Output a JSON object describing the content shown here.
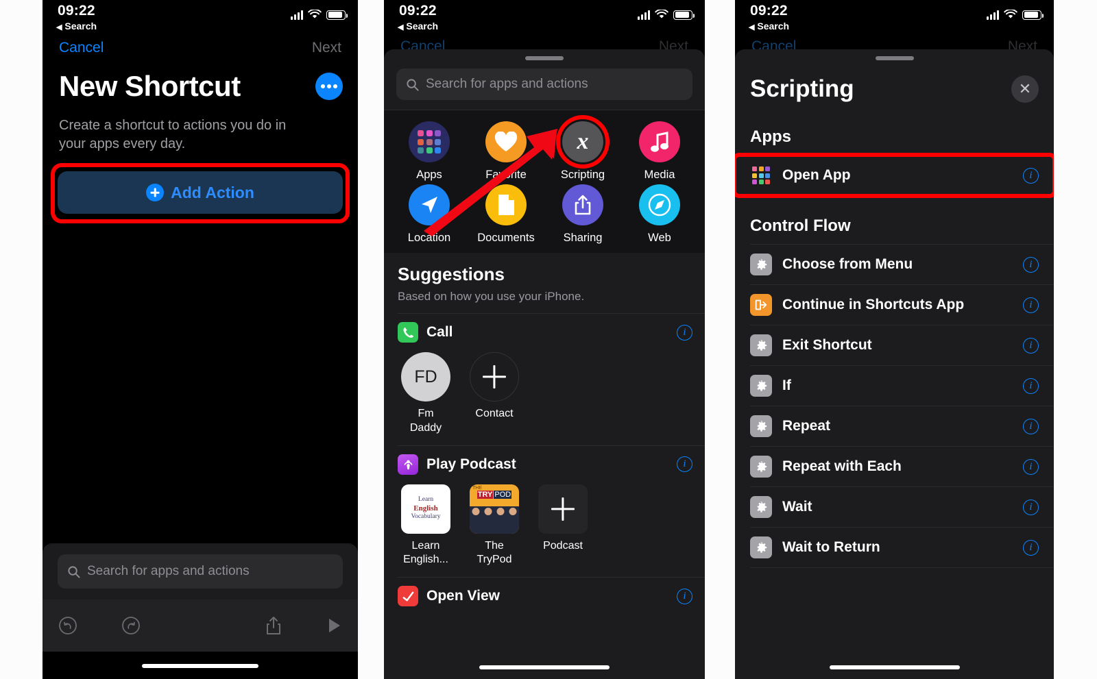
{
  "statusbar": {
    "time": "09:22",
    "back_label": "Search",
    "back_arrow": "◀"
  },
  "phone1": {
    "nav": {
      "cancel": "Cancel",
      "next": "Next"
    },
    "title": "New Shortcut",
    "more_icon": "ellipsis-icon",
    "subtitle": "Create a shortcut to actions you do in your apps every day.",
    "add_action_label": "Add Action",
    "search_placeholder": "Search for apps and actions",
    "toolbar": {
      "undo": "undo-icon",
      "redo": "redo-icon",
      "share": "share-icon",
      "play": "play-icon"
    }
  },
  "phone2": {
    "nav": {
      "cancel": "Cancel",
      "next": "Next"
    },
    "search_placeholder": "Search for apps and actions",
    "categories": [
      {
        "label": "Apps",
        "icon": "app-grid-icon",
        "color": "#2b2b63"
      },
      {
        "label": "Favorite",
        "icon": "heart-icon",
        "color": "#f59a23"
      },
      {
        "label": "Scripting",
        "icon": "x-script-icon",
        "color": "#555558",
        "highlighted": true
      },
      {
        "label": "Media",
        "icon": "music-note-icon",
        "color": "#f2256a"
      },
      {
        "label": "Location",
        "icon": "navigation-icon",
        "color": "#1a84f5"
      },
      {
        "label": "Documents",
        "icon": "document-icon",
        "color": "#fbbd0b"
      },
      {
        "label": "Sharing",
        "icon": "share-icon",
        "color": "#6159d6"
      },
      {
        "label": "Web",
        "icon": "compass-icon",
        "color": "#19c0ef"
      }
    ],
    "suggestions": {
      "title": "Suggestions",
      "subtitle": "Based on how you use your iPhone.",
      "groups": [
        {
          "name": "Call",
          "icon": "phone-icon",
          "icon_color": "#32c759",
          "info": "info-icon",
          "tiles": [
            {
              "label": "Fm\nDaddy",
              "kind": "avatar",
              "initials": "FD"
            },
            {
              "label": "Contact",
              "kind": "plus-circle"
            }
          ]
        },
        {
          "name": "Play Podcast",
          "icon": "podcast-icon",
          "icon_color": "#a835e0",
          "info": "info-icon",
          "tiles": [
            {
              "label": "Learn\nEnglish...",
              "kind": "art-learn-english"
            },
            {
              "label": "The\nTryPod",
              "kind": "art-trypod"
            },
            {
              "label": "Podcast",
              "kind": "plus-square"
            }
          ]
        },
        {
          "name": "Open View",
          "icon": "view-icon",
          "icon_color": "#f03b3b",
          "info": "info-icon",
          "tiles": []
        }
      ]
    },
    "annotation": {
      "arrow": "red-arrow",
      "ring": "red-ring"
    }
  },
  "phone3": {
    "nav": {
      "cancel": "Cancel",
      "next": "Next"
    },
    "title": "Scripting",
    "close_icon": "close-icon",
    "groups": [
      {
        "heading": "Apps",
        "items": [
          {
            "name": "Open App",
            "icon": "app-grid-icon",
            "icon_style": "multicolor-grid",
            "info": "info-icon",
            "highlighted": true
          }
        ]
      },
      {
        "heading": "Control Flow",
        "items": [
          {
            "name": "Choose from Menu",
            "icon": "gear-icon",
            "icon_style": "gray-gear",
            "info": "info-icon"
          },
          {
            "name": "Continue in Shortcuts App",
            "icon": "continue-icon",
            "icon_style": "orange-enter",
            "info": "info-icon"
          },
          {
            "name": "Exit Shortcut",
            "icon": "gear-icon",
            "icon_style": "gray-gear",
            "info": "info-icon"
          },
          {
            "name": "If",
            "icon": "gear-icon",
            "icon_style": "gray-gear",
            "info": "info-icon"
          },
          {
            "name": "Repeat",
            "icon": "gear-icon",
            "icon_style": "gray-gear",
            "info": "info-icon"
          },
          {
            "name": "Repeat with Each",
            "icon": "gear-icon",
            "icon_style": "gray-gear",
            "info": "info-icon"
          },
          {
            "name": "Wait",
            "icon": "gear-icon",
            "icon_style": "gray-gear",
            "info": "info-icon"
          },
          {
            "name": "Wait to Return",
            "icon": "gear-icon",
            "icon_style": "gray-gear",
            "info": "info-icon"
          }
        ]
      }
    ]
  },
  "colors": {
    "highlight_red": "#ff0000",
    "accent_blue": "#0a84ff",
    "sheet_bg": "#1c1c1e",
    "page_bg": "#000000"
  }
}
